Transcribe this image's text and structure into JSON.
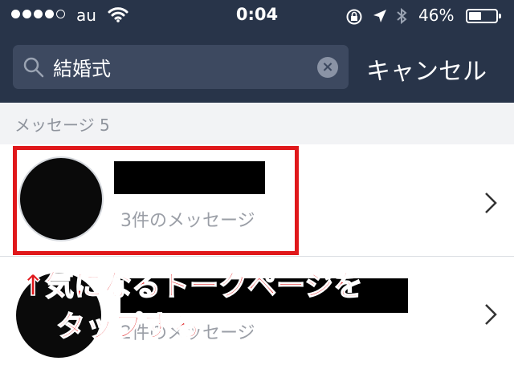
{
  "status_bar": {
    "carrier": "au",
    "time": "0:04",
    "battery_percent": "46%",
    "battery_level": 0.46
  },
  "search": {
    "query": "結婚式",
    "cancel_label": "キャンセル"
  },
  "section": {
    "title": "メッセージ 5"
  },
  "results": [
    {
      "subtitle": "3件のメッセージ"
    },
    {
      "subtitle": "2件のメッセージ"
    }
  ],
  "annotation": {
    "line1": "↑気になるトークページを",
    "line2": "タップする",
    "color": "#e0181b"
  },
  "colors": {
    "header_bg": "#283449",
    "search_bg": "#3d4960",
    "section_bg": "#f2f3f5"
  }
}
